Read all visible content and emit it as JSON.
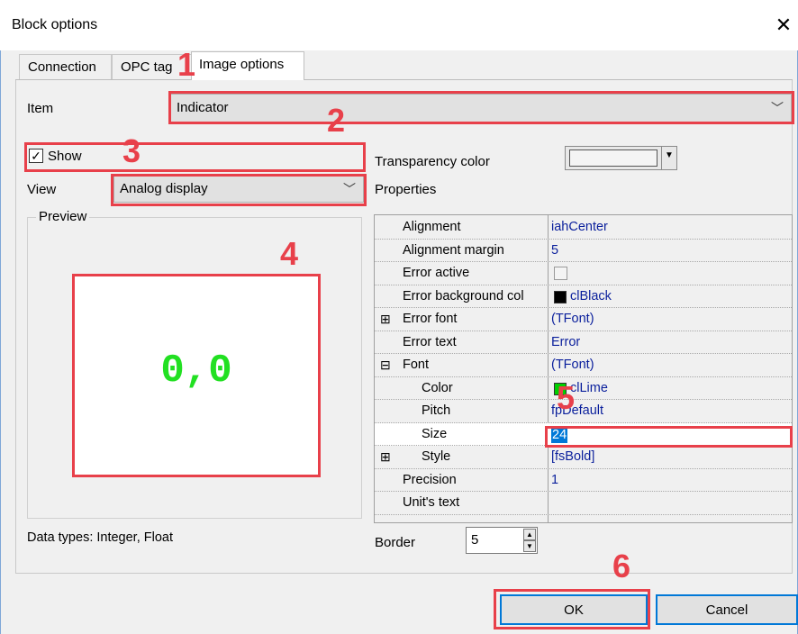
{
  "window": {
    "title": "Block options",
    "close_glyph": "✕"
  },
  "tabs": [
    {
      "label": "Connection"
    },
    {
      "label": "OPC tag"
    },
    {
      "label": "Image options"
    }
  ],
  "item": {
    "label": "Item",
    "value": "Indicator"
  },
  "show": {
    "label": "Show",
    "checked": true,
    "check_glyph": "✓"
  },
  "view": {
    "label": "View",
    "value": "Analog display"
  },
  "transparency": {
    "label": "Transparency color"
  },
  "properties": {
    "label": "Properties",
    "rows": [
      {
        "expander": "",
        "name": "Alignment",
        "value": "iahCenter"
      },
      {
        "expander": "",
        "name": "Alignment margin",
        "value": "5"
      },
      {
        "expander": "",
        "name": "Error active",
        "value": ""
      },
      {
        "expander": "",
        "name": "Error background col",
        "value": "clBlack",
        "swatch": "#000000"
      },
      {
        "expander": "⊞",
        "name": "Error font",
        "value": "(TFont)"
      },
      {
        "expander": "",
        "name": "Error text",
        "value": "Error"
      },
      {
        "expander": "⊟",
        "name": "Font",
        "value": "(TFont)"
      },
      {
        "expander": "",
        "name": "Color",
        "value": "clLime",
        "swatch": "#00d000",
        "indent": true
      },
      {
        "expander": "",
        "name": "Pitch",
        "value": "fpDefault",
        "indent": true
      },
      {
        "expander": "",
        "name": "Size",
        "value": "24",
        "indent": true,
        "selected": true
      },
      {
        "expander": "⊞",
        "name": "Style",
        "value": "[fsBold]",
        "indent": true
      },
      {
        "expander": "",
        "name": "Precision",
        "value": "1"
      },
      {
        "expander": "",
        "name": "Unit's text",
        "value": ""
      }
    ]
  },
  "preview": {
    "label": "Preview",
    "value": "0,0",
    "value_color": "#22e022"
  },
  "data_types": "Data types: Integer, Float",
  "border": {
    "label": "Border",
    "value": "5"
  },
  "buttons": {
    "ok": "OK",
    "cancel": "Cancel"
  },
  "annotations": [
    "1",
    "2",
    "3",
    "4",
    "5",
    "6"
  ],
  "colors": {
    "annotation": "#e8404a",
    "accent": "#0078d7"
  }
}
